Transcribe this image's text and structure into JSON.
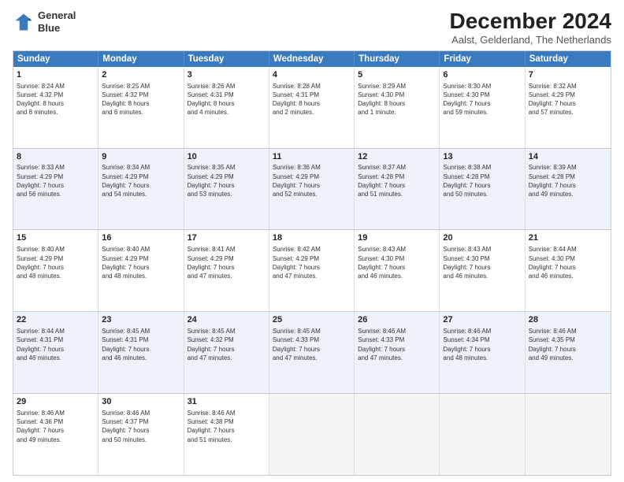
{
  "header": {
    "logo_line1": "General",
    "logo_line2": "Blue",
    "title": "December 2024",
    "subtitle": "Aalst, Gelderland, The Netherlands"
  },
  "calendar": {
    "days": [
      "Sunday",
      "Monday",
      "Tuesday",
      "Wednesday",
      "Thursday",
      "Friday",
      "Saturday"
    ],
    "rows": [
      [
        {
          "day": "1",
          "lines": [
            "Sunrise: 8:24 AM",
            "Sunset: 4:32 PM",
            "Daylight: 8 hours",
            "and 8 minutes."
          ]
        },
        {
          "day": "2",
          "lines": [
            "Sunrise: 8:25 AM",
            "Sunset: 4:32 PM",
            "Daylight: 8 hours",
            "and 6 minutes."
          ]
        },
        {
          "day": "3",
          "lines": [
            "Sunrise: 8:26 AM",
            "Sunset: 4:31 PM",
            "Daylight: 8 hours",
            "and 4 minutes."
          ]
        },
        {
          "day": "4",
          "lines": [
            "Sunrise: 8:28 AM",
            "Sunset: 4:31 PM",
            "Daylight: 8 hours",
            "and 2 minutes."
          ]
        },
        {
          "day": "5",
          "lines": [
            "Sunrise: 8:29 AM",
            "Sunset: 4:30 PM",
            "Daylight: 8 hours",
            "and 1 minute."
          ]
        },
        {
          "day": "6",
          "lines": [
            "Sunrise: 8:30 AM",
            "Sunset: 4:30 PM",
            "Daylight: 7 hours",
            "and 59 minutes."
          ]
        },
        {
          "day": "7",
          "lines": [
            "Sunrise: 8:32 AM",
            "Sunset: 4:29 PM",
            "Daylight: 7 hours",
            "and 57 minutes."
          ]
        }
      ],
      [
        {
          "day": "8",
          "lines": [
            "Sunrise: 8:33 AM",
            "Sunset: 4:29 PM",
            "Daylight: 7 hours",
            "and 56 minutes."
          ]
        },
        {
          "day": "9",
          "lines": [
            "Sunrise: 8:34 AM",
            "Sunset: 4:29 PM",
            "Daylight: 7 hours",
            "and 54 minutes."
          ]
        },
        {
          "day": "10",
          "lines": [
            "Sunrise: 8:35 AM",
            "Sunset: 4:29 PM",
            "Daylight: 7 hours",
            "and 53 minutes."
          ]
        },
        {
          "day": "11",
          "lines": [
            "Sunrise: 8:36 AM",
            "Sunset: 4:29 PM",
            "Daylight: 7 hours",
            "and 52 minutes."
          ]
        },
        {
          "day": "12",
          "lines": [
            "Sunrise: 8:37 AM",
            "Sunset: 4:28 PM",
            "Daylight: 7 hours",
            "and 51 minutes."
          ]
        },
        {
          "day": "13",
          "lines": [
            "Sunrise: 8:38 AM",
            "Sunset: 4:28 PM",
            "Daylight: 7 hours",
            "and 50 minutes."
          ]
        },
        {
          "day": "14",
          "lines": [
            "Sunrise: 8:39 AM",
            "Sunset: 4:28 PM",
            "Daylight: 7 hours",
            "and 49 minutes."
          ]
        }
      ],
      [
        {
          "day": "15",
          "lines": [
            "Sunrise: 8:40 AM",
            "Sunset: 4:29 PM",
            "Daylight: 7 hours",
            "and 48 minutes."
          ]
        },
        {
          "day": "16",
          "lines": [
            "Sunrise: 8:40 AM",
            "Sunset: 4:29 PM",
            "Daylight: 7 hours",
            "and 48 minutes."
          ]
        },
        {
          "day": "17",
          "lines": [
            "Sunrise: 8:41 AM",
            "Sunset: 4:29 PM",
            "Daylight: 7 hours",
            "and 47 minutes."
          ]
        },
        {
          "day": "18",
          "lines": [
            "Sunrise: 8:42 AM",
            "Sunset: 4:29 PM",
            "Daylight: 7 hours",
            "and 47 minutes."
          ]
        },
        {
          "day": "19",
          "lines": [
            "Sunrise: 8:43 AM",
            "Sunset: 4:30 PM",
            "Daylight: 7 hours",
            "and 46 minutes."
          ]
        },
        {
          "day": "20",
          "lines": [
            "Sunrise: 8:43 AM",
            "Sunset: 4:30 PM",
            "Daylight: 7 hours",
            "and 46 minutes."
          ]
        },
        {
          "day": "21",
          "lines": [
            "Sunrise: 8:44 AM",
            "Sunset: 4:30 PM",
            "Daylight: 7 hours",
            "and 46 minutes."
          ]
        }
      ],
      [
        {
          "day": "22",
          "lines": [
            "Sunrise: 8:44 AM",
            "Sunset: 4:31 PM",
            "Daylight: 7 hours",
            "and 46 minutes."
          ]
        },
        {
          "day": "23",
          "lines": [
            "Sunrise: 8:45 AM",
            "Sunset: 4:31 PM",
            "Daylight: 7 hours",
            "and 46 minutes."
          ]
        },
        {
          "day": "24",
          "lines": [
            "Sunrise: 8:45 AM",
            "Sunset: 4:32 PM",
            "Daylight: 7 hours",
            "and 47 minutes."
          ]
        },
        {
          "day": "25",
          "lines": [
            "Sunrise: 8:45 AM",
            "Sunset: 4:33 PM",
            "Daylight: 7 hours",
            "and 47 minutes."
          ]
        },
        {
          "day": "26",
          "lines": [
            "Sunrise: 8:46 AM",
            "Sunset: 4:33 PM",
            "Daylight: 7 hours",
            "and 47 minutes."
          ]
        },
        {
          "day": "27",
          "lines": [
            "Sunrise: 8:46 AM",
            "Sunset: 4:34 PM",
            "Daylight: 7 hours",
            "and 48 minutes."
          ]
        },
        {
          "day": "28",
          "lines": [
            "Sunrise: 8:46 AM",
            "Sunset: 4:35 PM",
            "Daylight: 7 hours",
            "and 49 minutes."
          ]
        }
      ],
      [
        {
          "day": "29",
          "lines": [
            "Sunrise: 8:46 AM",
            "Sunset: 4:36 PM",
            "Daylight: 7 hours",
            "and 49 minutes."
          ]
        },
        {
          "day": "30",
          "lines": [
            "Sunrise: 8:46 AM",
            "Sunset: 4:37 PM",
            "Daylight: 7 hours",
            "and 50 minutes."
          ]
        },
        {
          "day": "31",
          "lines": [
            "Sunrise: 8:46 AM",
            "Sunset: 4:38 PM",
            "Daylight: 7 hours",
            "and 51 minutes."
          ]
        },
        {
          "day": "",
          "lines": []
        },
        {
          "day": "",
          "lines": []
        },
        {
          "day": "",
          "lines": []
        },
        {
          "day": "",
          "lines": []
        }
      ]
    ]
  }
}
